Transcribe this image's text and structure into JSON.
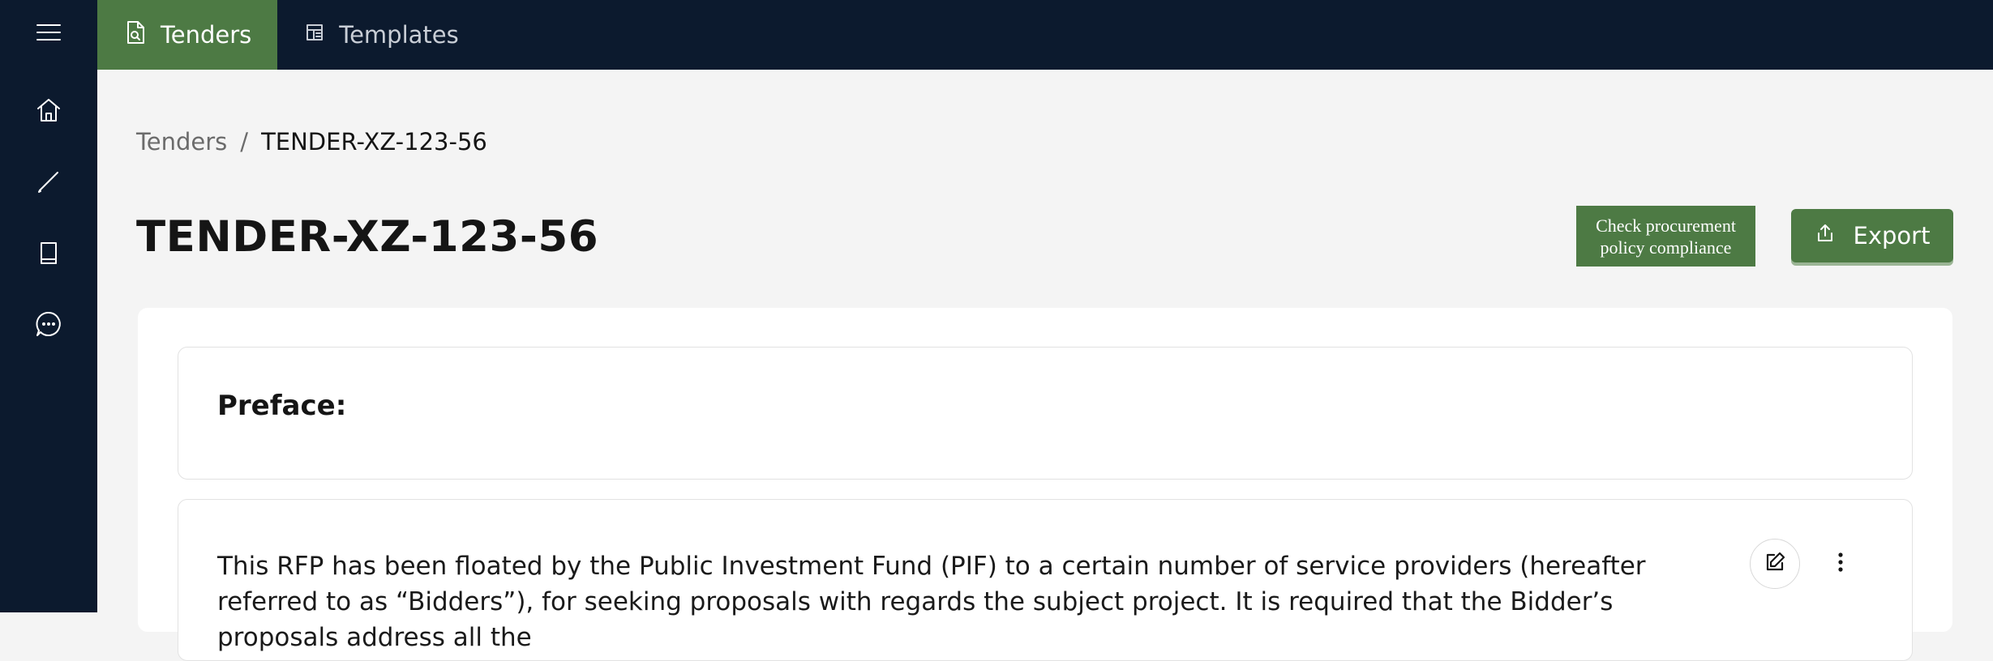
{
  "sidebar": {
    "menu_icon": "hamburger-menu-icon",
    "items": [
      {
        "icon": "home-icon"
      },
      {
        "icon": "pencil-icon"
      },
      {
        "icon": "book-icon"
      },
      {
        "icon": "chat-bubble-icon"
      }
    ]
  },
  "topbar": {
    "tabs": [
      {
        "label": "Tenders",
        "icon": "document-search-icon",
        "active": true
      },
      {
        "label": "Templates",
        "icon": "template-icon",
        "active": false
      }
    ]
  },
  "breadcrumb": {
    "parent": "Tenders",
    "separator": "/",
    "current": "TENDER-XZ-123-56"
  },
  "page": {
    "title": "TENDER-XZ-123-56"
  },
  "actions": {
    "compliance_label": "Check procurement policy compliance",
    "export_label": "Export",
    "export_icon": "share-upload-icon"
  },
  "sections": {
    "preface_label": "Preface:",
    "content_text": "This RFP has been floated by the Public Investment Fund (PIF) to a certain number of service providers (hereafter referred to as “Bidders”), for seeking proposals with regards the subject project. It is required that the Bidder’s proposals address all the",
    "edit_icon": "edit-icon",
    "more_icon": "more-vertical-icon"
  },
  "colors": {
    "nav_bg": "#0c1a2e",
    "accent_green": "#4d7a44",
    "page_bg": "#f4f4f4"
  }
}
